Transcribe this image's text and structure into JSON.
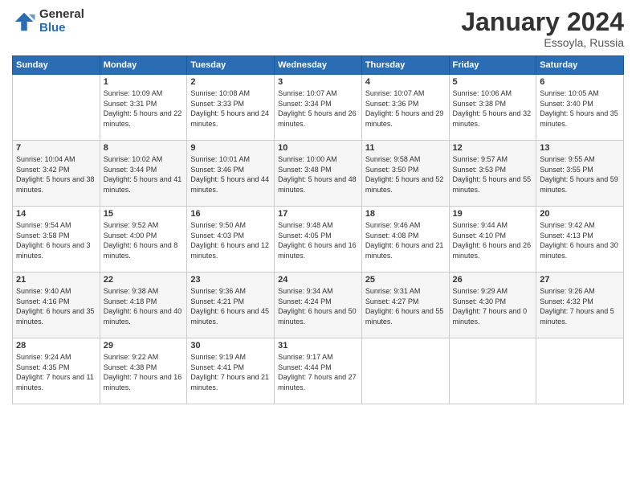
{
  "header": {
    "logo_general": "General",
    "logo_blue": "Blue",
    "month_title": "January 2024",
    "location": "Essoyla, Russia"
  },
  "days_of_week": [
    "Sunday",
    "Monday",
    "Tuesday",
    "Wednesday",
    "Thursday",
    "Friday",
    "Saturday"
  ],
  "weeks": [
    {
      "days": [
        {
          "number": "",
          "sunrise": "",
          "sunset": "",
          "daylight": ""
        },
        {
          "number": "1",
          "sunrise": "Sunrise: 10:09 AM",
          "sunset": "Sunset: 3:31 PM",
          "daylight": "Daylight: 5 hours and 22 minutes."
        },
        {
          "number": "2",
          "sunrise": "Sunrise: 10:08 AM",
          "sunset": "Sunset: 3:33 PM",
          "daylight": "Daylight: 5 hours and 24 minutes."
        },
        {
          "number": "3",
          "sunrise": "Sunrise: 10:07 AM",
          "sunset": "Sunset: 3:34 PM",
          "daylight": "Daylight: 5 hours and 26 minutes."
        },
        {
          "number": "4",
          "sunrise": "Sunrise: 10:07 AM",
          "sunset": "Sunset: 3:36 PM",
          "daylight": "Daylight: 5 hours and 29 minutes."
        },
        {
          "number": "5",
          "sunrise": "Sunrise: 10:06 AM",
          "sunset": "Sunset: 3:38 PM",
          "daylight": "Daylight: 5 hours and 32 minutes."
        },
        {
          "number": "6",
          "sunrise": "Sunrise: 10:05 AM",
          "sunset": "Sunset: 3:40 PM",
          "daylight": "Daylight: 5 hours and 35 minutes."
        }
      ]
    },
    {
      "days": [
        {
          "number": "7",
          "sunrise": "Sunrise: 10:04 AM",
          "sunset": "Sunset: 3:42 PM",
          "daylight": "Daylight: 5 hours and 38 minutes."
        },
        {
          "number": "8",
          "sunrise": "Sunrise: 10:02 AM",
          "sunset": "Sunset: 3:44 PM",
          "daylight": "Daylight: 5 hours and 41 minutes."
        },
        {
          "number": "9",
          "sunrise": "Sunrise: 10:01 AM",
          "sunset": "Sunset: 3:46 PM",
          "daylight": "Daylight: 5 hours and 44 minutes."
        },
        {
          "number": "10",
          "sunrise": "Sunrise: 10:00 AM",
          "sunset": "Sunset: 3:48 PM",
          "daylight": "Daylight: 5 hours and 48 minutes."
        },
        {
          "number": "11",
          "sunrise": "Sunrise: 9:58 AM",
          "sunset": "Sunset: 3:50 PM",
          "daylight": "Daylight: 5 hours and 52 minutes."
        },
        {
          "number": "12",
          "sunrise": "Sunrise: 9:57 AM",
          "sunset": "Sunset: 3:53 PM",
          "daylight": "Daylight: 5 hours and 55 minutes."
        },
        {
          "number": "13",
          "sunrise": "Sunrise: 9:55 AM",
          "sunset": "Sunset: 3:55 PM",
          "daylight": "Daylight: 5 hours and 59 minutes."
        }
      ]
    },
    {
      "days": [
        {
          "number": "14",
          "sunrise": "Sunrise: 9:54 AM",
          "sunset": "Sunset: 3:58 PM",
          "daylight": "Daylight: 6 hours and 3 minutes."
        },
        {
          "number": "15",
          "sunrise": "Sunrise: 9:52 AM",
          "sunset": "Sunset: 4:00 PM",
          "daylight": "Daylight: 6 hours and 8 minutes."
        },
        {
          "number": "16",
          "sunrise": "Sunrise: 9:50 AM",
          "sunset": "Sunset: 4:03 PM",
          "daylight": "Daylight: 6 hours and 12 minutes."
        },
        {
          "number": "17",
          "sunrise": "Sunrise: 9:48 AM",
          "sunset": "Sunset: 4:05 PM",
          "daylight": "Daylight: 6 hours and 16 minutes."
        },
        {
          "number": "18",
          "sunrise": "Sunrise: 9:46 AM",
          "sunset": "Sunset: 4:08 PM",
          "daylight": "Daylight: 6 hours and 21 minutes."
        },
        {
          "number": "19",
          "sunrise": "Sunrise: 9:44 AM",
          "sunset": "Sunset: 4:10 PM",
          "daylight": "Daylight: 6 hours and 26 minutes."
        },
        {
          "number": "20",
          "sunrise": "Sunrise: 9:42 AM",
          "sunset": "Sunset: 4:13 PM",
          "daylight": "Daylight: 6 hours and 30 minutes."
        }
      ]
    },
    {
      "days": [
        {
          "number": "21",
          "sunrise": "Sunrise: 9:40 AM",
          "sunset": "Sunset: 4:16 PM",
          "daylight": "Daylight: 6 hours and 35 minutes."
        },
        {
          "number": "22",
          "sunrise": "Sunrise: 9:38 AM",
          "sunset": "Sunset: 4:18 PM",
          "daylight": "Daylight: 6 hours and 40 minutes."
        },
        {
          "number": "23",
          "sunrise": "Sunrise: 9:36 AM",
          "sunset": "Sunset: 4:21 PM",
          "daylight": "Daylight: 6 hours and 45 minutes."
        },
        {
          "number": "24",
          "sunrise": "Sunrise: 9:34 AM",
          "sunset": "Sunset: 4:24 PM",
          "daylight": "Daylight: 6 hours and 50 minutes."
        },
        {
          "number": "25",
          "sunrise": "Sunrise: 9:31 AM",
          "sunset": "Sunset: 4:27 PM",
          "daylight": "Daylight: 6 hours and 55 minutes."
        },
        {
          "number": "26",
          "sunrise": "Sunrise: 9:29 AM",
          "sunset": "Sunset: 4:30 PM",
          "daylight": "Daylight: 7 hours and 0 minutes."
        },
        {
          "number": "27",
          "sunrise": "Sunrise: 9:26 AM",
          "sunset": "Sunset: 4:32 PM",
          "daylight": "Daylight: 7 hours and 5 minutes."
        }
      ]
    },
    {
      "days": [
        {
          "number": "28",
          "sunrise": "Sunrise: 9:24 AM",
          "sunset": "Sunset: 4:35 PM",
          "daylight": "Daylight: 7 hours and 11 minutes."
        },
        {
          "number": "29",
          "sunrise": "Sunrise: 9:22 AM",
          "sunset": "Sunset: 4:38 PM",
          "daylight": "Daylight: 7 hours and 16 minutes."
        },
        {
          "number": "30",
          "sunrise": "Sunrise: 9:19 AM",
          "sunset": "Sunset: 4:41 PM",
          "daylight": "Daylight: 7 hours and 21 minutes."
        },
        {
          "number": "31",
          "sunrise": "Sunrise: 9:17 AM",
          "sunset": "Sunset: 4:44 PM",
          "daylight": "Daylight: 7 hours and 27 minutes."
        },
        {
          "number": "",
          "sunrise": "",
          "sunset": "",
          "daylight": ""
        },
        {
          "number": "",
          "sunrise": "",
          "sunset": "",
          "daylight": ""
        },
        {
          "number": "",
          "sunrise": "",
          "sunset": "",
          "daylight": ""
        }
      ]
    }
  ]
}
